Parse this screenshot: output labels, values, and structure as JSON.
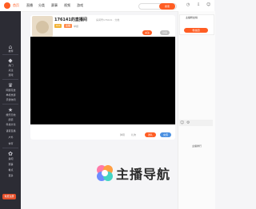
{
  "header": {
    "logo": "首页",
    "nav": [
      "直播",
      "分类",
      "赛事",
      "视频",
      "游戏",
      "娱乐"
    ],
    "search_placeholder": "",
    "search_button": "搜索",
    "user_label": "登录",
    "history_label": "历史",
    "download_label": "客户端"
  },
  "sidebar": {
    "items": [
      "推荐",
      "热门",
      "关注",
      "游戏",
      "网游竞技",
      "单机热游",
      "手游休闲",
      "娱乐天地",
      "颜值",
      "科技文化",
      "语音直播",
      "户外",
      "体育",
      "鱼吧",
      "赛事",
      "看点",
      "更多"
    ],
    "register_button": "免费注册"
  },
  "room": {
    "title": "176141的直播间",
    "subtitle": "房间号176141 · 分类",
    "tag_level": "LV1",
    "tag_host": "主播",
    "follow": "关注",
    "share": "分享",
    "report": "举报",
    "bottom_actions": [
      "弹幕",
      "礼物"
    ],
    "gift_button": "送礼",
    "charge_button": "充值"
  },
  "right_panel": {
    "title": "主播粉丝榜",
    "fans_button": "粉丝团",
    "rank_label": "主播排行"
  },
  "watermark": {
    "text": "主播导航"
  },
  "colors": {
    "accent": "#ff5d23",
    "sidebar": "#2c2c34",
    "player": "#000000"
  }
}
